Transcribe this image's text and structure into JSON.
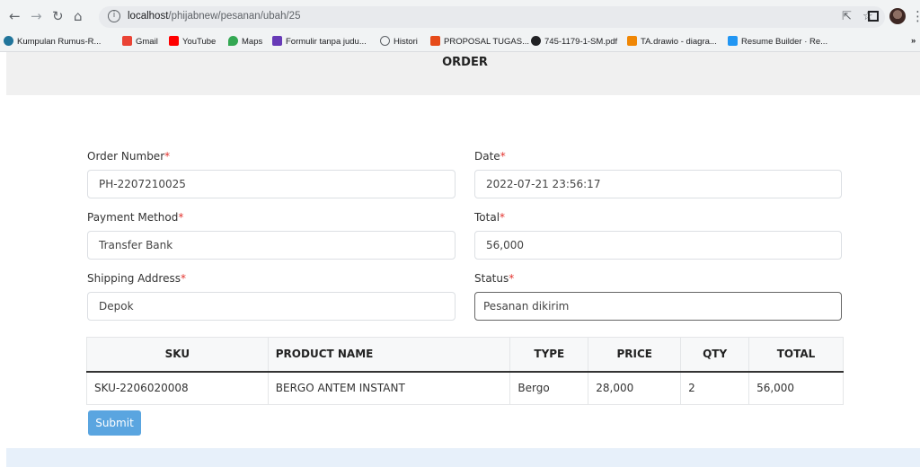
{
  "browser": {
    "url_host": "localhost",
    "url_path": "/phijabnew/pesanan/ubah/25",
    "bookmarks": [
      {
        "label": "Kumpulan Rumus-R...",
        "icon": "wordpress-icon",
        "color": "#21759b"
      },
      {
        "label": "Gmail",
        "icon": "gmail-icon",
        "color": "#ea4335"
      },
      {
        "label": "YouTube",
        "icon": "youtube-icon",
        "color": "#ff0000"
      },
      {
        "label": "Maps",
        "icon": "maps-icon",
        "color": "#34a853"
      },
      {
        "label": "Formulir tanpa judu...",
        "icon": "forms-icon",
        "color": "#673ab7"
      },
      {
        "label": "Histori",
        "icon": "history-icon",
        "color": "#5f6368"
      },
      {
        "label": "PROPOSAL TUGAS...",
        "icon": "pdf-icon",
        "color": "#e64a19"
      },
      {
        "label": "745-1179-1-SM.pdf",
        "icon": "globe-icon",
        "color": "#202124"
      },
      {
        "label": "TA.drawio - diagra...",
        "icon": "drawio-icon",
        "color": "#f08705"
      },
      {
        "label": "Resume Builder · Re...",
        "icon": "resume-icon",
        "color": "#2196f3"
      }
    ]
  },
  "page": {
    "title": "ORDER"
  },
  "form": {
    "order_number": {
      "label": "Order Number",
      "required": "*",
      "value": "PH-2207210025"
    },
    "date": {
      "label": "Date",
      "required": "*",
      "value": "2022-07-21 23:56:17"
    },
    "payment_method": {
      "label": "Payment Method",
      "required": "*",
      "value": "Transfer Bank"
    },
    "total": {
      "label": "Total",
      "required": "*",
      "value": "56,000"
    },
    "shipping_address": {
      "label": "Shipping Address",
      "required": "*",
      "value": "Depok"
    },
    "status": {
      "label": "Status",
      "required": "*",
      "value": "Pesanan dikirim"
    }
  },
  "table": {
    "headers": [
      "SKU",
      "PRODUCT NAME",
      "TYPE",
      "PRICE",
      "QTY",
      "TOTAL"
    ],
    "rows": [
      [
        "SKU-2206020008",
        "BERGO ANTEM INSTANT",
        "Bergo",
        "28,000",
        "2",
        "56,000"
      ]
    ]
  },
  "actions": {
    "submit_label": "Submit"
  },
  "colors": {
    "submit": "#5aa5e0",
    "required": "#e3342f",
    "header_bg": "#f0f0f0",
    "footer_bg": "#e7f0fa"
  }
}
